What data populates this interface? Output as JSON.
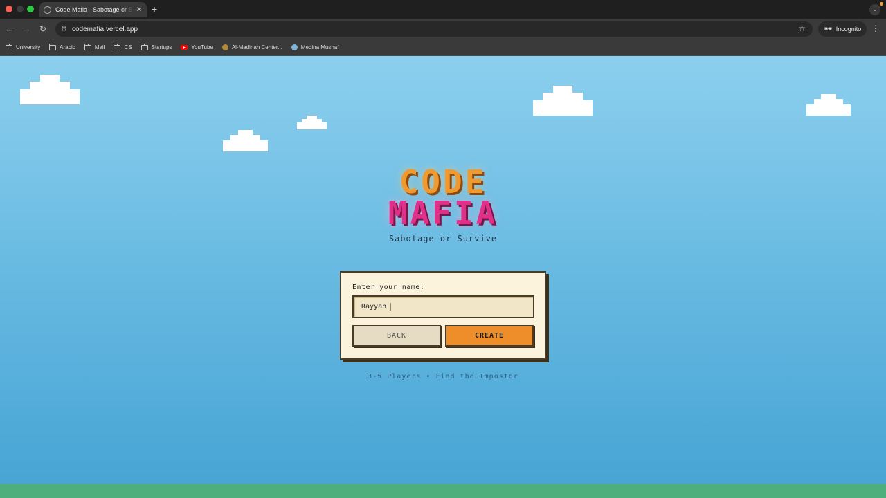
{
  "browser": {
    "tab_title": "Code Mafia - Sabotage or Survive",
    "url": "codemafia.vercel.app",
    "incognito_label": "Incognito",
    "bookmarks": [
      {
        "label": "University",
        "icon": "folder-icon"
      },
      {
        "label": "Arabic",
        "icon": "folder-icon"
      },
      {
        "label": "Mail",
        "icon": "folder-icon"
      },
      {
        "label": "CS",
        "icon": "folder-icon"
      },
      {
        "label": "Startups",
        "icon": "folder-icon"
      },
      {
        "label": "YouTube",
        "icon": "youtube-icon"
      },
      {
        "label": "Al-Madinah Center...",
        "icon": "site-favicon-icon"
      },
      {
        "label": "Medina Mushaf",
        "icon": "site-favicon-icon"
      }
    ],
    "accent_colors": {
      "tab_bar": "#1f1f1f",
      "toolbar": "#3a3a3a"
    }
  },
  "app": {
    "logo_line1": "CODE",
    "logo_line2": "MAFIA",
    "tagline": "Sabotage or Survive",
    "form": {
      "label": "Enter your name:",
      "name_value": "Rayyan",
      "back_label": "BACK",
      "create_label": "CREATE"
    },
    "footer_note": "3-5 Players • Find the Impostor",
    "colors": {
      "logo_code": "#f0992f",
      "logo_mafia": "#e0308a",
      "create_button": "#ee8e2a",
      "card_bg": "#fbf3dc",
      "sky_top": "#8ccfee",
      "sky_bottom": "#45a3d3",
      "ground": "#4eae7c"
    }
  }
}
